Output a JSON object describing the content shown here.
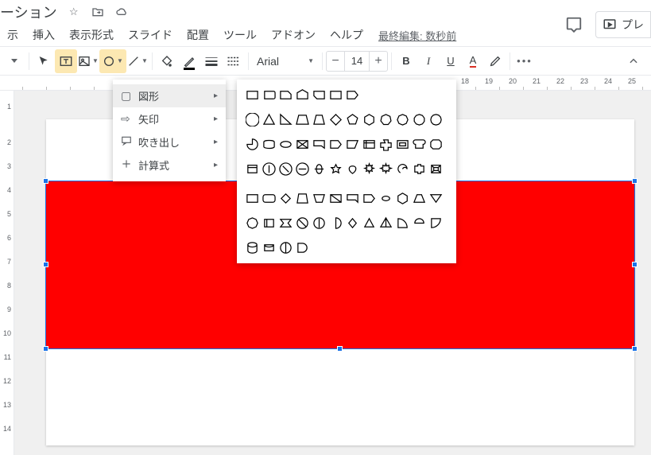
{
  "title_suffix": "ーション",
  "menu": [
    "示",
    "挿入",
    "表示形式",
    "スライド",
    "配置",
    "ツール",
    "アドオン",
    "ヘルプ"
  ],
  "last_edit": "最終編集: 数秒前",
  "present_btn": "プレ",
  "font_name": "Arial",
  "font_size": "14",
  "bold": "B",
  "italic": "I",
  "underline": "U",
  "text_color": "A",
  "dropdown_items": [
    {
      "icon": "□",
      "label": "図形"
    },
    {
      "icon": "⇨",
      "label": "矢印"
    },
    {
      "icon": "💬",
      "label": "吹き出し"
    },
    {
      "icon": "＋",
      "label": "計算式"
    }
  ],
  "hruler_ticks": [
    {
      "p": 18,
      "n": ""
    },
    {
      "p": 38,
      "n": ""
    },
    {
      "p": 575,
      "n": "18"
    },
    {
      "p": 605,
      "n": "19"
    },
    {
      "p": 635,
      "n": "20"
    },
    {
      "p": 665,
      "n": "21"
    },
    {
      "p": 695,
      "n": "22"
    },
    {
      "p": 725,
      "n": "23"
    },
    {
      "p": 755,
      "n": "24"
    },
    {
      "p": 785,
      "n": "25"
    }
  ],
  "vruler_ticks": [
    {
      "p": 15,
      "n": "1"
    },
    {
      "p": 45,
      "n": ""
    },
    {
      "p": 60,
      "n": "2"
    },
    {
      "p": 90,
      "n": "3"
    },
    {
      "p": 120,
      "n": "4"
    },
    {
      "p": 150,
      "n": "5"
    },
    {
      "p": 180,
      "n": "6"
    },
    {
      "p": 210,
      "n": "7"
    },
    {
      "p": 240,
      "n": "8"
    },
    {
      "p": 270,
      "n": "9"
    },
    {
      "p": 300,
      "n": "10"
    },
    {
      "p": 330,
      "n": "11"
    },
    {
      "p": 360,
      "n": "12"
    },
    {
      "p": 390,
      "n": "13"
    },
    {
      "p": 420,
      "n": "14"
    }
  ]
}
